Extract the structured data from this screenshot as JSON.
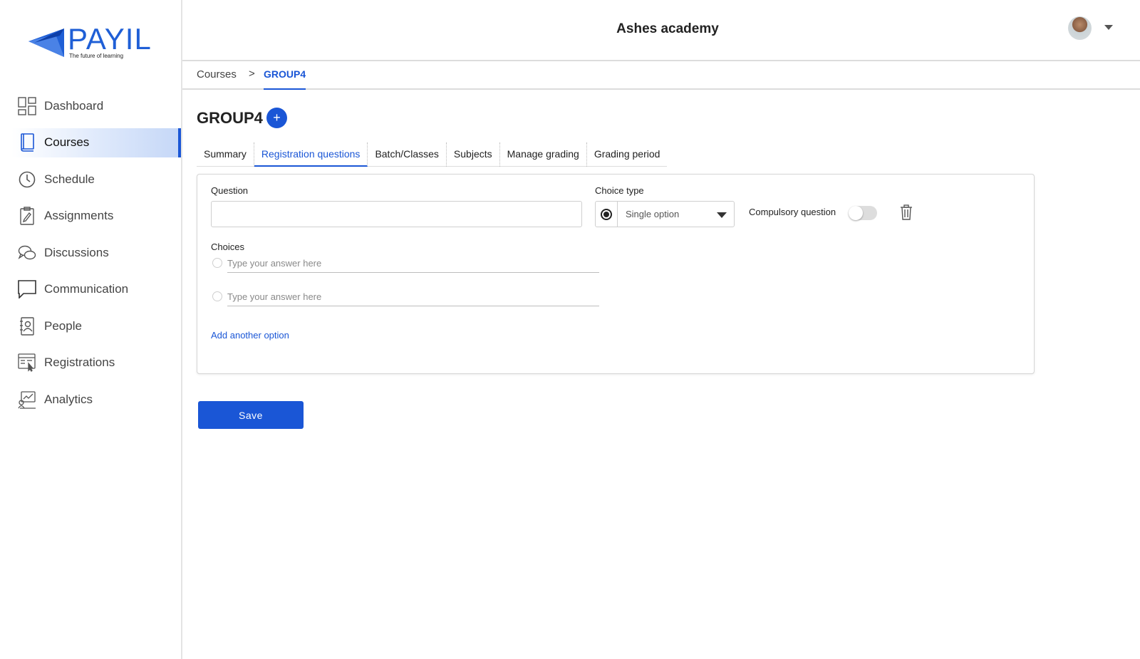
{
  "brand": {
    "name": "PAYIL",
    "tagline": "The future of learning",
    "color": "#1f5fd6"
  },
  "sidebar": {
    "items": [
      {
        "label": "Dashboard",
        "icon": "dashboard-icon"
      },
      {
        "label": "Courses",
        "icon": "book-icon",
        "active": true
      },
      {
        "label": "Schedule",
        "icon": "clock-icon"
      },
      {
        "label": "Assignments",
        "icon": "clipboard-icon"
      },
      {
        "label": "Discussions",
        "icon": "chat-bubbles-icon"
      },
      {
        "label": "Communication",
        "icon": "message-icon"
      },
      {
        "label": "People",
        "icon": "contacts-icon"
      },
      {
        "label": "Registrations",
        "icon": "registration-icon"
      },
      {
        "label": "Analytics",
        "icon": "analytics-icon"
      }
    ]
  },
  "header": {
    "title": "Ashes academy"
  },
  "breadcrumb": {
    "root": "Courses",
    "separator": ">",
    "current": "GROUP4"
  },
  "page": {
    "title": "GROUP4",
    "add_symbol": "+"
  },
  "tabs": [
    {
      "label": "Summary"
    },
    {
      "label": "Registration questions",
      "active": true
    },
    {
      "label": "Batch/Classes"
    },
    {
      "label": "Subjects"
    },
    {
      "label": "Manage grading"
    },
    {
      "label": "Grading period"
    }
  ],
  "form": {
    "question_label": "Question",
    "question_value": "",
    "choice_type_label": "Choice type",
    "choice_type_value": "Single option",
    "compulsory_label": "Compulsory question",
    "compulsory_on": false,
    "choices_label": "Choices",
    "choices": [
      {
        "placeholder": "Type your answer here",
        "value": ""
      },
      {
        "placeholder": "Type your answer here",
        "value": ""
      }
    ],
    "add_option_label": "Add another option"
  },
  "actions": {
    "save_label": "Save"
  },
  "colors": {
    "accent": "#1a56d6",
    "border": "#d6d6d6",
    "active_nav_bg": "#c5d7f7"
  }
}
